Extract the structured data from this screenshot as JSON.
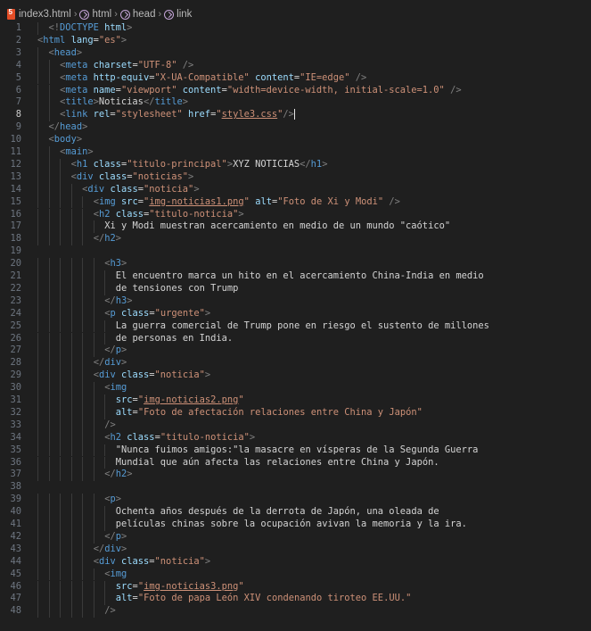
{
  "breadcrumb": {
    "file": "index3.html",
    "items": [
      "html",
      "head",
      "link"
    ]
  },
  "editor": {
    "active_line": 8,
    "lines": [
      {
        "n": 1,
        "indent": 1,
        "tokens": [
          [
            "p",
            "<!"
          ],
          [
            "t",
            "DOCTYPE"
          ],
          [
            "tx",
            " "
          ],
          [
            "a",
            "html"
          ],
          [
            "p",
            ">"
          ]
        ]
      },
      {
        "n": 2,
        "indent": 0,
        "tokens": [
          [
            "p",
            "<"
          ],
          [
            "t",
            "html"
          ],
          [
            "tx",
            " "
          ],
          [
            "a",
            "lang"
          ],
          [
            "tx",
            "="
          ],
          [
            "s",
            "\"es\""
          ],
          [
            "p",
            ">"
          ]
        ]
      },
      {
        "n": 3,
        "indent": 1,
        "tokens": [
          [
            "p",
            "<"
          ],
          [
            "t",
            "head"
          ],
          [
            "p",
            ">"
          ]
        ]
      },
      {
        "n": 4,
        "indent": 2,
        "tokens": [
          [
            "p",
            "<"
          ],
          [
            "t",
            "meta"
          ],
          [
            "tx",
            " "
          ],
          [
            "a",
            "charset"
          ],
          [
            "tx",
            "="
          ],
          [
            "s",
            "\"UTF-8\""
          ],
          [
            "tx",
            " "
          ],
          [
            "p",
            "/>"
          ]
        ]
      },
      {
        "n": 5,
        "indent": 2,
        "tokens": [
          [
            "p",
            "<"
          ],
          [
            "t",
            "meta"
          ],
          [
            "tx",
            " "
          ],
          [
            "a",
            "http-equiv"
          ],
          [
            "tx",
            "="
          ],
          [
            "s",
            "\"X-UA-Compatible\""
          ],
          [
            "tx",
            " "
          ],
          [
            "a",
            "content"
          ],
          [
            "tx",
            "="
          ],
          [
            "s",
            "\"IE=edge\""
          ],
          [
            "tx",
            " "
          ],
          [
            "p",
            "/>"
          ]
        ]
      },
      {
        "n": 6,
        "indent": 2,
        "tokens": [
          [
            "p",
            "<"
          ],
          [
            "t",
            "meta"
          ],
          [
            "tx",
            " "
          ],
          [
            "a",
            "name"
          ],
          [
            "tx",
            "="
          ],
          [
            "s",
            "\"viewport\""
          ],
          [
            "tx",
            " "
          ],
          [
            "a",
            "content"
          ],
          [
            "tx",
            "="
          ],
          [
            "s",
            "\"width=device-width, initial-scale=1.0\""
          ],
          [
            "tx",
            " "
          ],
          [
            "p",
            "/>"
          ]
        ]
      },
      {
        "n": 7,
        "indent": 2,
        "tokens": [
          [
            "p",
            "<"
          ],
          [
            "t",
            "title"
          ],
          [
            "p",
            ">"
          ],
          [
            "tx",
            "Noticias"
          ],
          [
            "p",
            "</"
          ],
          [
            "t",
            "title"
          ],
          [
            "p",
            ">"
          ]
        ]
      },
      {
        "n": 8,
        "indent": 2,
        "caret": true,
        "tokens": [
          [
            "p",
            "<"
          ],
          [
            "t",
            "link"
          ],
          [
            "tx",
            " "
          ],
          [
            "a",
            "rel"
          ],
          [
            "tx",
            "="
          ],
          [
            "s",
            "\"stylesheet\""
          ],
          [
            "tx",
            " "
          ],
          [
            "a",
            "href"
          ],
          [
            "tx",
            "="
          ],
          [
            "s",
            "\""
          ],
          [
            "su",
            "style3.css"
          ],
          [
            "s",
            "\""
          ],
          [
            "p",
            "/>"
          ]
        ]
      },
      {
        "n": 9,
        "indent": 1,
        "tokens": [
          [
            "p",
            "</"
          ],
          [
            "t",
            "head"
          ],
          [
            "p",
            ">"
          ]
        ]
      },
      {
        "n": 10,
        "indent": 1,
        "tokens": [
          [
            "p",
            "<"
          ],
          [
            "t",
            "body"
          ],
          [
            "p",
            ">"
          ]
        ]
      },
      {
        "n": 11,
        "indent": 2,
        "tokens": [
          [
            "p",
            "<"
          ],
          [
            "t",
            "main"
          ],
          [
            "p",
            ">"
          ]
        ]
      },
      {
        "n": 12,
        "indent": 3,
        "tokens": [
          [
            "p",
            "<"
          ],
          [
            "t",
            "h1"
          ],
          [
            "tx",
            " "
          ],
          [
            "a",
            "class"
          ],
          [
            "tx",
            "="
          ],
          [
            "s",
            "\"titulo-principal\""
          ],
          [
            "p",
            ">"
          ],
          [
            "tx",
            "XYZ NOTICIAS"
          ],
          [
            "p",
            "</"
          ],
          [
            "t",
            "h1"
          ],
          [
            "p",
            ">"
          ]
        ]
      },
      {
        "n": 13,
        "indent": 3,
        "tokens": [
          [
            "p",
            "<"
          ],
          [
            "t",
            "div"
          ],
          [
            "tx",
            " "
          ],
          [
            "a",
            "class"
          ],
          [
            "tx",
            "="
          ],
          [
            "s",
            "\"noticias\""
          ],
          [
            "p",
            ">"
          ]
        ]
      },
      {
        "n": 14,
        "indent": 4,
        "tokens": [
          [
            "p",
            "<"
          ],
          [
            "t",
            "div"
          ],
          [
            "tx",
            " "
          ],
          [
            "a",
            "class"
          ],
          [
            "tx",
            "="
          ],
          [
            "s",
            "\"noticia\""
          ],
          [
            "p",
            ">"
          ]
        ]
      },
      {
        "n": 15,
        "indent": 5,
        "tokens": [
          [
            "p",
            "<"
          ],
          [
            "t",
            "img"
          ],
          [
            "tx",
            " "
          ],
          [
            "a",
            "src"
          ],
          [
            "tx",
            "="
          ],
          [
            "s",
            "\""
          ],
          [
            "su",
            "img-noticias1.png"
          ],
          [
            "s",
            "\""
          ],
          [
            "tx",
            " "
          ],
          [
            "a",
            "alt"
          ],
          [
            "tx",
            "="
          ],
          [
            "s",
            "\"Foto de Xi y Modi\""
          ],
          [
            "tx",
            " "
          ],
          [
            "p",
            "/>"
          ]
        ]
      },
      {
        "n": 16,
        "indent": 5,
        "tokens": [
          [
            "p",
            "<"
          ],
          [
            "t",
            "h2"
          ],
          [
            "tx",
            " "
          ],
          [
            "a",
            "class"
          ],
          [
            "tx",
            "="
          ],
          [
            "s",
            "\"titulo-noticia\""
          ],
          [
            "p",
            ">"
          ]
        ]
      },
      {
        "n": 17,
        "indent": 6,
        "tokens": [
          [
            "tx",
            "Xi y Modi muestran acercamiento en medio de un mundo \"caótico\""
          ]
        ]
      },
      {
        "n": 18,
        "indent": 5,
        "tokens": [
          [
            "p",
            "</"
          ],
          [
            "t",
            "h2"
          ],
          [
            "p",
            ">"
          ]
        ]
      },
      {
        "n": 19,
        "indent": 0,
        "tokens": []
      },
      {
        "n": 20,
        "indent": 6,
        "tokens": [
          [
            "p",
            "<"
          ],
          [
            "t",
            "h3"
          ],
          [
            "p",
            ">"
          ]
        ]
      },
      {
        "n": 21,
        "indent": 7,
        "tokens": [
          [
            "tx",
            "El encuentro marca un hito en el acercamiento China-India en medio"
          ]
        ]
      },
      {
        "n": 22,
        "indent": 7,
        "tokens": [
          [
            "tx",
            "de tensiones con Trump"
          ]
        ]
      },
      {
        "n": 23,
        "indent": 6,
        "tokens": [
          [
            "p",
            "</"
          ],
          [
            "t",
            "h3"
          ],
          [
            "p",
            ">"
          ]
        ]
      },
      {
        "n": 24,
        "indent": 6,
        "tokens": [
          [
            "p",
            "<"
          ],
          [
            "t",
            "p"
          ],
          [
            "tx",
            " "
          ],
          [
            "a",
            "class"
          ],
          [
            "tx",
            "="
          ],
          [
            "s",
            "\"urgente\""
          ],
          [
            "p",
            ">"
          ]
        ]
      },
      {
        "n": 25,
        "indent": 7,
        "tokens": [
          [
            "tx",
            "La guerra comercial de Trump pone en riesgo el sustento de millones"
          ]
        ]
      },
      {
        "n": 26,
        "indent": 7,
        "tokens": [
          [
            "tx",
            "de personas en India."
          ]
        ]
      },
      {
        "n": 27,
        "indent": 6,
        "tokens": [
          [
            "p",
            "</"
          ],
          [
            "t",
            "p"
          ],
          [
            "p",
            ">"
          ]
        ]
      },
      {
        "n": 28,
        "indent": 5,
        "tokens": [
          [
            "p",
            "</"
          ],
          [
            "t",
            "div"
          ],
          [
            "p",
            ">"
          ]
        ]
      },
      {
        "n": 29,
        "indent": 5,
        "tokens": [
          [
            "p",
            "<"
          ],
          [
            "t",
            "div"
          ],
          [
            "tx",
            " "
          ],
          [
            "a",
            "class"
          ],
          [
            "tx",
            "="
          ],
          [
            "s",
            "\"noticia\""
          ],
          [
            "p",
            ">"
          ]
        ]
      },
      {
        "n": 30,
        "indent": 6,
        "tokens": [
          [
            "p",
            "<"
          ],
          [
            "t",
            "img"
          ]
        ]
      },
      {
        "n": 31,
        "indent": 7,
        "tokens": [
          [
            "a",
            "src"
          ],
          [
            "tx",
            "="
          ],
          [
            "s",
            "\""
          ],
          [
            "su",
            "img-noticias2.png"
          ],
          [
            "s",
            "\""
          ]
        ]
      },
      {
        "n": 32,
        "indent": 7,
        "tokens": [
          [
            "a",
            "alt"
          ],
          [
            "tx",
            "="
          ],
          [
            "s",
            "\"Foto de afectación relaciones entre China y Japón\""
          ]
        ]
      },
      {
        "n": 33,
        "indent": 6,
        "tokens": [
          [
            "p",
            "/>"
          ]
        ]
      },
      {
        "n": 34,
        "indent": 6,
        "tokens": [
          [
            "p",
            "<"
          ],
          [
            "t",
            "h2"
          ],
          [
            "tx",
            " "
          ],
          [
            "a",
            "class"
          ],
          [
            "tx",
            "="
          ],
          [
            "s",
            "\"titulo-noticia\""
          ],
          [
            "p",
            ">"
          ]
        ]
      },
      {
        "n": 35,
        "indent": 7,
        "tokens": [
          [
            "tx",
            "\"Nunca fuimos amigos:\"la masacre en vísperas de la Segunda Guerra"
          ]
        ]
      },
      {
        "n": 36,
        "indent": 7,
        "tokens": [
          [
            "tx",
            "Mundial que aún afecta las relaciones entre China y Japón."
          ]
        ]
      },
      {
        "n": 37,
        "indent": 6,
        "tokens": [
          [
            "p",
            "</"
          ],
          [
            "t",
            "h2"
          ],
          [
            "p",
            ">"
          ]
        ]
      },
      {
        "n": 38,
        "indent": 0,
        "tokens": []
      },
      {
        "n": 39,
        "indent": 6,
        "tokens": [
          [
            "p",
            "<"
          ],
          [
            "t",
            "p"
          ],
          [
            "p",
            ">"
          ]
        ]
      },
      {
        "n": 40,
        "indent": 7,
        "tokens": [
          [
            "tx",
            "Ochenta años después de la derrota de Japón, una oleada de"
          ]
        ]
      },
      {
        "n": 41,
        "indent": 7,
        "tokens": [
          [
            "tx",
            "películas chinas sobre la ocupación avivan la memoria y la ira."
          ]
        ]
      },
      {
        "n": 42,
        "indent": 6,
        "tokens": [
          [
            "p",
            "</"
          ],
          [
            "t",
            "p"
          ],
          [
            "p",
            ">"
          ]
        ]
      },
      {
        "n": 43,
        "indent": 5,
        "tokens": [
          [
            "p",
            "</"
          ],
          [
            "t",
            "div"
          ],
          [
            "p",
            ">"
          ]
        ]
      },
      {
        "n": 44,
        "indent": 5,
        "tokens": [
          [
            "p",
            "<"
          ],
          [
            "t",
            "div"
          ],
          [
            "tx",
            " "
          ],
          [
            "a",
            "class"
          ],
          [
            "tx",
            "="
          ],
          [
            "s",
            "\"noticia\""
          ],
          [
            "p",
            ">"
          ]
        ]
      },
      {
        "n": 45,
        "indent": 6,
        "tokens": [
          [
            "p",
            "<"
          ],
          [
            "t",
            "img"
          ]
        ]
      },
      {
        "n": 46,
        "indent": 7,
        "tokens": [
          [
            "a",
            "src"
          ],
          [
            "tx",
            "="
          ],
          [
            "s",
            "\""
          ],
          [
            "su",
            "img-noticias3.png"
          ],
          [
            "s",
            "\""
          ]
        ]
      },
      {
        "n": 47,
        "indent": 7,
        "tokens": [
          [
            "a",
            "alt"
          ],
          [
            "tx",
            "="
          ],
          [
            "s",
            "\"Foto de papa León XIV condenando tiroteo EE.UU.\""
          ]
        ]
      },
      {
        "n": 48,
        "indent": 6,
        "tokens": [
          [
            "p",
            "/>"
          ]
        ]
      }
    ]
  }
}
